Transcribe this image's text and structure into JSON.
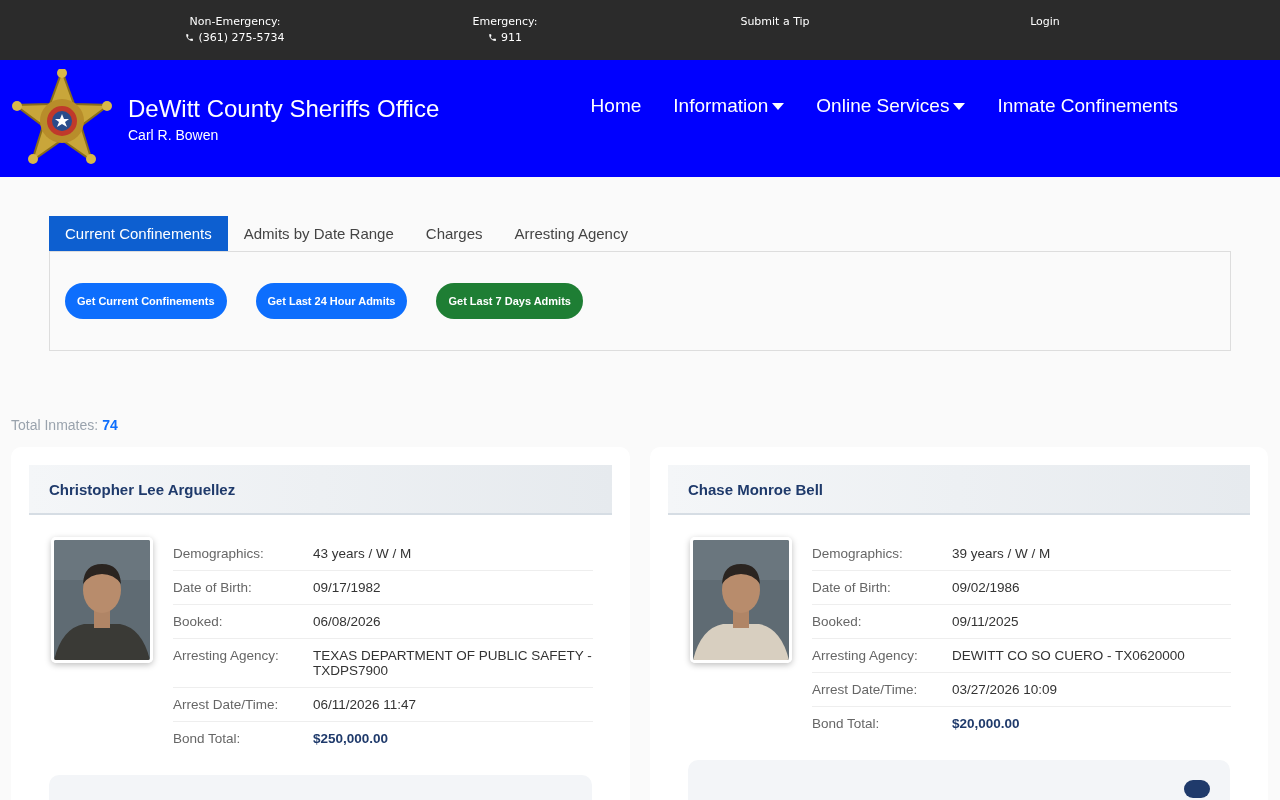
{
  "top_bar": [
    {
      "label": "Non-Emergency:",
      "phone": "(361) 275-5734"
    },
    {
      "label": "Emergency:",
      "phone": "911"
    },
    {
      "label": "Submit a Tip"
    },
    {
      "label": "Login"
    }
  ],
  "header": {
    "title": "DeWitt County Sheriffs Office",
    "subtitle": "Carl R. Bowen"
  },
  "nav": [
    {
      "label": "Home",
      "has_menu": false
    },
    {
      "label": "Information",
      "has_menu": true
    },
    {
      "label": "Online Services",
      "has_menu": true
    },
    {
      "label": "Inmate Confinements",
      "has_menu": false
    }
  ],
  "tabs": [
    {
      "label": "Current Confinements",
      "selected": true
    },
    {
      "label": "Admits by Date Range",
      "selected": false
    },
    {
      "label": "Charges",
      "selected": false
    },
    {
      "label": "Arresting Agency",
      "selected": false
    }
  ],
  "buttons": [
    {
      "label": "Get Current Confinements",
      "color": "#0d6efd"
    },
    {
      "label": "Get Last 24 Hour Admits",
      "color": "#0d6efd"
    },
    {
      "label": "Get Last 7 Days Admits",
      "color": "#1e7e34"
    }
  ],
  "total": {
    "label": "Total Inmates:",
    "value": "74"
  },
  "inmates": [
    {
      "name": "Christopher Lee Arguellez",
      "count_badge": false,
      "fields": [
        {
          "label": "Demographics:",
          "value": "43 years / W / M",
          "kind": "text"
        },
        {
          "label": "Date of Birth:",
          "value": "09/17/1982",
          "kind": "text"
        },
        {
          "label": "Booked:",
          "value": "06/08/2026",
          "kind": "text"
        },
        {
          "label": "Arresting Agency:",
          "value": "TEXAS DEPARTMENT OF PUBLIC SAFETY - TXDPS7900",
          "kind": "text"
        },
        {
          "label": "Arrest Date/Time:",
          "value": "06/11/2026 11:47",
          "kind": "text"
        },
        {
          "label": "Bond Total:",
          "value": "$250,000.00",
          "kind": "money"
        }
      ]
    },
    {
      "name": "Chase Monroe Bell",
      "count_badge": true,
      "fields": [
        {
          "label": "Demographics:",
          "value": "39 years / W / M",
          "kind": "text"
        },
        {
          "label": "Date of Birth:",
          "value": "09/02/1986",
          "kind": "text"
        },
        {
          "label": "Booked:",
          "value": "09/11/2025",
          "kind": "text"
        },
        {
          "label": "Arresting Agency:",
          "value": "DEWITT CO SO CUERO - TX0620000",
          "kind": "text"
        },
        {
          "label": "Arrest Date/Time:",
          "value": "03/27/2026 10:09",
          "kind": "text"
        },
        {
          "label": "Bond Total:",
          "value": "$20,000.00",
          "kind": "money"
        }
      ]
    }
  ]
}
